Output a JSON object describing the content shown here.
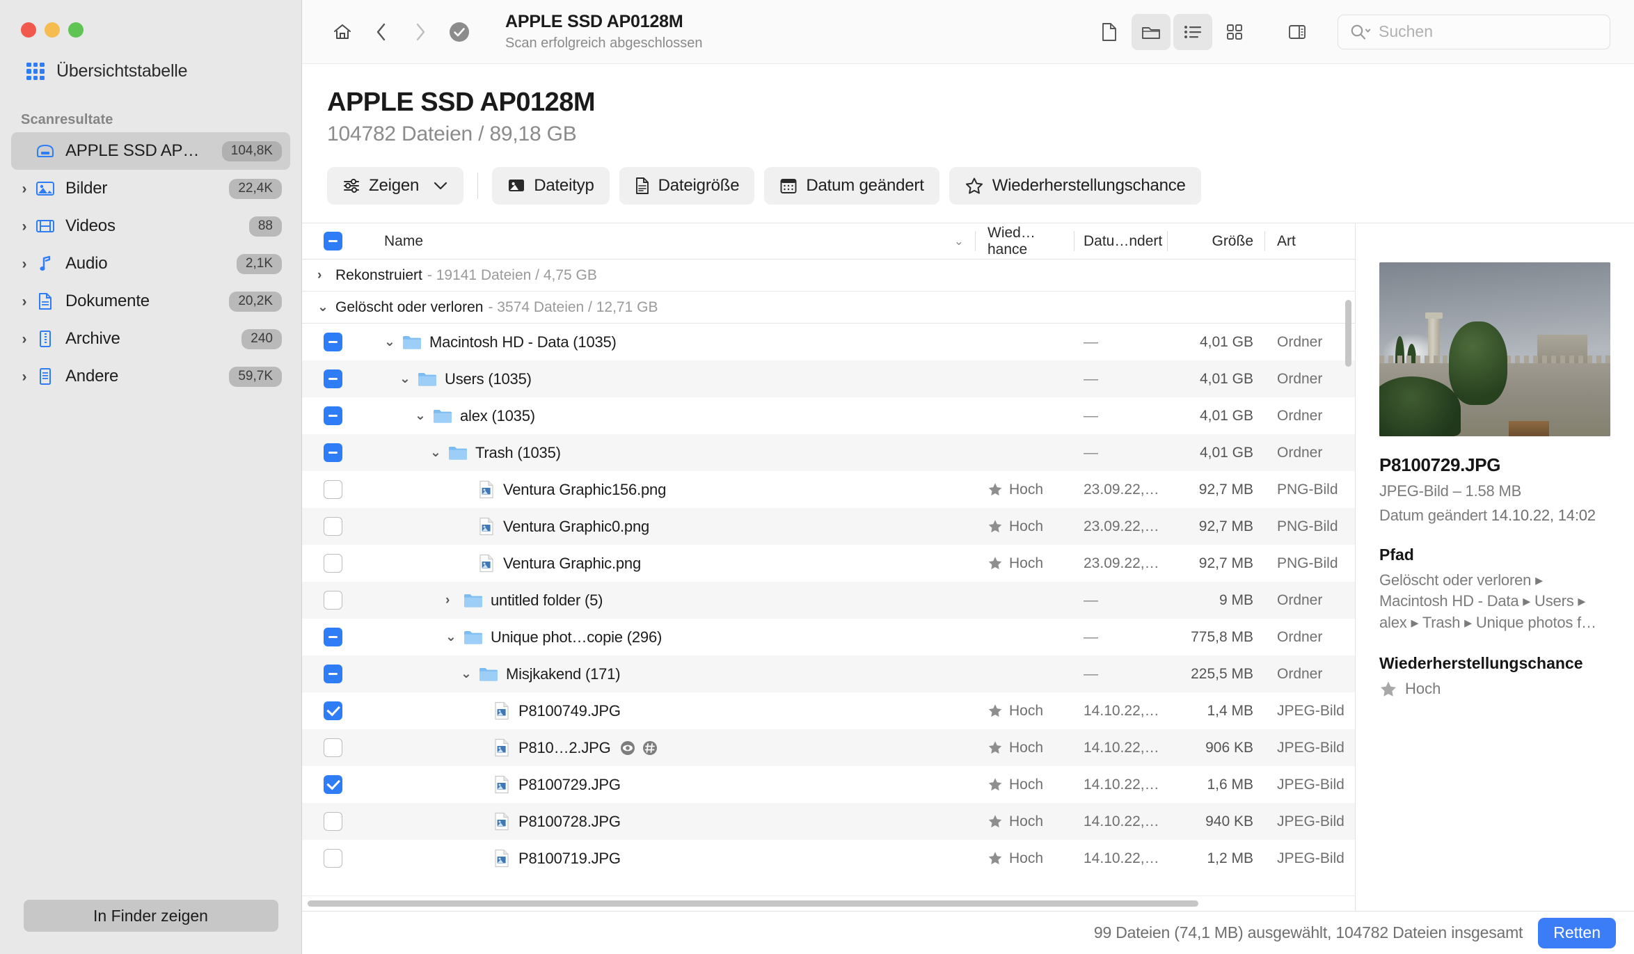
{
  "window": {
    "traffic_lights": [
      "close",
      "minimize",
      "maximize"
    ]
  },
  "sidebar": {
    "overview_label": "Übersichtstabelle",
    "overview_icon": "grid-icon",
    "section_label": "Scanresultate",
    "items": [
      {
        "label": "APPLE SSD AP…",
        "badge": "104,8K",
        "icon": "disk-icon",
        "selected": true,
        "expandable": false
      },
      {
        "label": "Bilder",
        "badge": "22,4K",
        "icon": "photo-icon",
        "selected": false,
        "expandable": true
      },
      {
        "label": "Videos",
        "badge": "88",
        "icon": "film-icon",
        "selected": false,
        "expandable": true
      },
      {
        "label": "Audio",
        "badge": "2,1K",
        "icon": "music-icon",
        "selected": false,
        "expandable": true
      },
      {
        "label": "Dokumente",
        "badge": "20,2K",
        "icon": "document-icon",
        "selected": false,
        "expandable": true
      },
      {
        "label": "Archive",
        "badge": "240",
        "icon": "archive-icon",
        "selected": false,
        "expandable": true
      },
      {
        "label": "Andere",
        "badge": "59,7K",
        "icon": "other-icon",
        "selected": false,
        "expandable": true
      }
    ],
    "finder_button": "In Finder zeigen"
  },
  "toolbar": {
    "title": "APPLE SSD AP0128M",
    "subtitle": "Scan erfolgreich abgeschlossen",
    "home_icon": "home-icon",
    "back_icon": "chevron-left-icon",
    "forward_icon": "chevron-right-icon",
    "status_icon": "checkmark-circle-icon",
    "view_buttons": [
      {
        "icon": "file-view-icon",
        "active": false
      },
      {
        "icon": "folder-view-icon",
        "active": true
      },
      {
        "icon": "list-view-icon",
        "active": true
      },
      {
        "icon": "grid-view-icon",
        "active": false
      }
    ],
    "sidebar_toggle_icon": "sidebar-panel-icon",
    "search": {
      "icon": "search-icon",
      "placeholder": "Suchen",
      "value": ""
    }
  },
  "content": {
    "title": "APPLE SSD AP0128M",
    "subtitle": "104782 Dateien / 89,18 GB",
    "filters": [
      {
        "label": "Zeigen",
        "icon": "sliders-icon",
        "caret": "chevron-down-icon"
      },
      {
        "label": "Dateityp",
        "icon": "photo-filter-icon"
      },
      {
        "label": "Dateigröße",
        "icon": "document-filter-icon"
      },
      {
        "label": "Datum geändert",
        "icon": "calendar-icon"
      },
      {
        "label": "Wiederherstellungschance",
        "icon": "star-outline-icon"
      }
    ]
  },
  "table": {
    "header": {
      "select_all_state": "mixed",
      "columns": [
        "Name",
        "Wied…hance",
        "Datu…ndert",
        "Größe",
        "Art"
      ],
      "sort_caret": "chevron-down-icon"
    },
    "groups": [
      {
        "caret": "collapsed",
        "name": "Rekonstruiert",
        "meta": "- 19141 Dateien / 4,75 GB"
      },
      {
        "caret": "expanded",
        "name": "Gelöscht oder verloren",
        "meta": "- 3574 Dateien / 12,71 GB"
      }
    ],
    "rows": [
      {
        "check": "mixed",
        "depth": 0,
        "caret": "expanded",
        "icon": "folder-icon",
        "name": "Macintosh HD - Data (1035)",
        "chance": "",
        "date": "",
        "size": "4,01 GB",
        "type": "Ordner",
        "alt": false
      },
      {
        "check": "mixed",
        "depth": 1,
        "caret": "expanded",
        "icon": "folder-icon",
        "name": "Users (1035)",
        "chance": "",
        "date": "",
        "size": "4,01 GB",
        "type": "Ordner",
        "alt": true
      },
      {
        "check": "mixed",
        "depth": 2,
        "caret": "expanded",
        "icon": "folder-icon",
        "name": "alex (1035)",
        "chance": "",
        "date": "",
        "size": "4,01 GB",
        "type": "Ordner",
        "alt": false
      },
      {
        "check": "mixed",
        "depth": 3,
        "caret": "expanded",
        "icon": "folder-icon",
        "name": "Trash (1035)",
        "chance": "",
        "date": "",
        "size": "4,01 GB",
        "type": "Ordner",
        "alt": true
      },
      {
        "check": "empty",
        "depth": 5,
        "caret": "none",
        "icon": "image-file-icon",
        "name": "Ventura Graphic156.png",
        "chance": "Hoch",
        "date": "23.09.22,…",
        "size": "92,7 MB",
        "type": "PNG-Bild",
        "alt": false
      },
      {
        "check": "empty",
        "depth": 5,
        "caret": "none",
        "icon": "image-file-icon",
        "name": "Ventura Graphic0.png",
        "chance": "Hoch",
        "date": "23.09.22,…",
        "size": "92,7 MB",
        "type": "PNG-Bild",
        "alt": true
      },
      {
        "check": "empty",
        "depth": 5,
        "caret": "none",
        "icon": "image-file-icon",
        "name": "Ventura Graphic.png",
        "chance": "Hoch",
        "date": "23.09.22,…",
        "size": "92,7 MB",
        "type": "PNG-Bild",
        "alt": false
      },
      {
        "check": "empty",
        "depth": 4,
        "caret": "collapsed",
        "icon": "folder-icon",
        "name": "untitled folder (5)",
        "chance": "",
        "date": "",
        "size": "9 MB",
        "type": "Ordner",
        "alt": true
      },
      {
        "check": "mixed",
        "depth": 4,
        "caret": "expanded",
        "icon": "folder-icon",
        "name": "Unique phot…copie (296)",
        "chance": "",
        "date": "",
        "size": "775,8 MB",
        "type": "Ordner",
        "alt": false
      },
      {
        "check": "mixed",
        "depth": 5,
        "caret": "expanded",
        "icon": "folder-icon",
        "name": "Misjkakend (171)",
        "chance": "",
        "date": "",
        "size": "225,5 MB",
        "type": "Ordner",
        "alt": true
      },
      {
        "check": "checked",
        "depth": 6,
        "caret": "none",
        "icon": "image-file-icon",
        "name": "P8100749.JPG",
        "chance": "Hoch",
        "date": "14.10.22,…",
        "size": "1,4 MB",
        "type": "JPEG-Bild",
        "alt": false
      },
      {
        "check": "empty",
        "depth": 6,
        "caret": "none",
        "icon": "image-file-icon",
        "name": "P810…2.JPG",
        "chance": "Hoch",
        "date": "14.10.22,…",
        "size": "906 KB",
        "type": "JPEG-Bild",
        "alt": true,
        "badges": [
          "preview-eye-icon",
          "hash-icon"
        ]
      },
      {
        "check": "checked",
        "depth": 6,
        "caret": "none",
        "icon": "image-file-icon",
        "name": "P8100729.JPG",
        "chance": "Hoch",
        "date": "14.10.22,…",
        "size": "1,6 MB",
        "type": "JPEG-Bild",
        "alt": false
      },
      {
        "check": "empty",
        "depth": 6,
        "caret": "none",
        "icon": "image-file-icon",
        "name": "P8100728.JPG",
        "chance": "Hoch",
        "date": "14.10.22,…",
        "size": "940 KB",
        "type": "JPEG-Bild",
        "alt": true
      },
      {
        "check": "empty",
        "depth": 6,
        "caret": "none",
        "icon": "image-file-icon",
        "name": "P8100719.JPG",
        "chance": "Hoch",
        "date": "14.10.22,…",
        "size": "1,2 MB",
        "type": "JPEG-Bild",
        "alt": false
      }
    ],
    "empty_dash": "—"
  },
  "preview": {
    "thumbnail_alt": "castle-photo-thumbnail",
    "filename": "P8100729.JPG",
    "kind_and_size": "JPEG-Bild – 1.58 MB",
    "date_label": "Datum geändert",
    "date_value": "14.10.22, 14:02",
    "path_label": "Pfad",
    "path_value": "Gelöscht oder verloren ▸ Macintosh HD - Data ▸ Users ▸ alex ▸ Trash ▸ Unique photos f…",
    "chance_label": "Wiederherstellungschance",
    "chance_value": "Hoch",
    "chance_icon": "star-icon"
  },
  "statusbar": {
    "text": "99 Dateien (74,1 MB) ausgewählt, 104782 Dateien insgesamt",
    "button": "Retten"
  },
  "colors": {
    "accent": "#2f7df6",
    "primary_button": "#3b7df6",
    "sidebar_bg": "#e8e8e8",
    "selected_row": "#cfcfcf",
    "badge_bg": "#b9b9b9"
  }
}
